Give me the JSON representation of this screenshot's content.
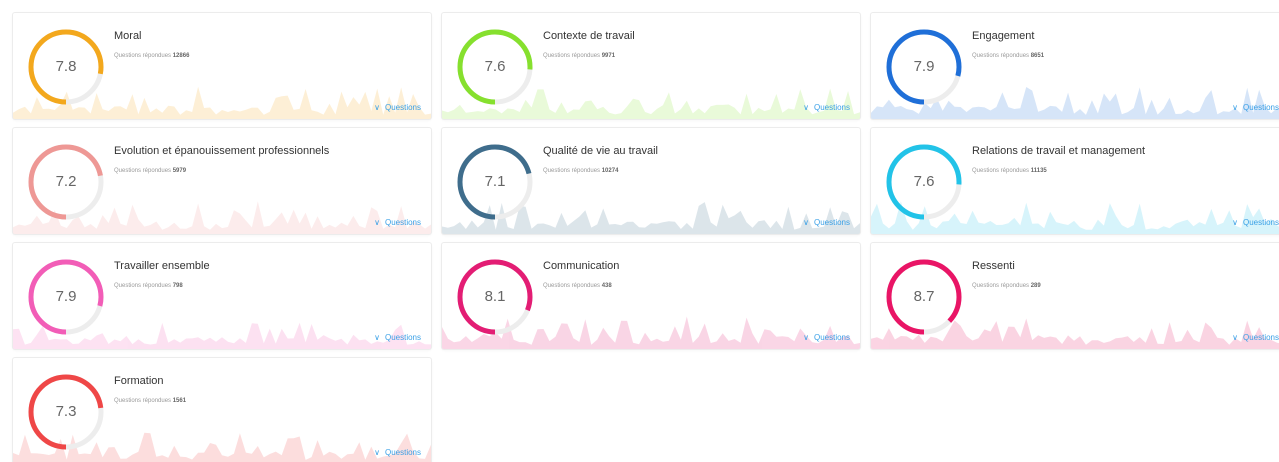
{
  "cards": [
    {
      "title": "Moral",
      "score": "7.8",
      "answers_label": "Questions répondues",
      "answers_count": "12866",
      "questions_label": "Questions",
      "color": "#f3a81d",
      "value": 0.78
    },
    {
      "title": "Contexte de travail",
      "score": "7.6",
      "answers_label": "Questions répondues",
      "answers_count": "9971",
      "questions_label": "Questions",
      "color": "#86e02e",
      "value": 0.76
    },
    {
      "title": "Engagement",
      "score": "7.9",
      "answers_label": "Questions répondues",
      "answers_count": "8651",
      "questions_label": "Questions",
      "color": "#1f6fd8",
      "value": 0.79
    },
    {
      "title": "Evolution et épanouissement professionnels",
      "score": "7.2",
      "answers_label": "Questions répondues",
      "answers_count": "5979",
      "questions_label": "Questions",
      "color": "#ee9895",
      "value": 0.72
    },
    {
      "title": "Qualité de vie au travail",
      "score": "7.1",
      "answers_label": "Questions répondues",
      "answers_count": "10274",
      "questions_label": "Questions",
      "color": "#3f6d8c",
      "value": 0.71
    },
    {
      "title": "Relations de travail et management",
      "score": "7.6",
      "answers_label": "Questions répondues",
      "answers_count": "11135",
      "questions_label": "Questions",
      "color": "#22c3e8",
      "value": 0.76
    },
    {
      "title": "Travailler ensemble",
      "score": "7.9",
      "answers_label": "Questions répondues",
      "answers_count": "798",
      "questions_label": "Questions",
      "color": "#f25db7",
      "value": 0.79
    },
    {
      "title": "Communication",
      "score": "8.1",
      "answers_label": "Questions répondues",
      "answers_count": "438",
      "questions_label": "Questions",
      "color": "#e31d74",
      "value": 0.81
    },
    {
      "title": "Ressenti",
      "score": "8.7",
      "answers_label": "Questions répondues",
      "answers_count": "289",
      "questions_label": "Questions",
      "color": "#e91566",
      "value": 0.87
    },
    {
      "title": "Formation",
      "score": "7.3",
      "answers_label": "Questions répondues",
      "answers_count": "1561",
      "questions_label": "Questions",
      "color": "#ef4747",
      "value": 0.73
    }
  ]
}
